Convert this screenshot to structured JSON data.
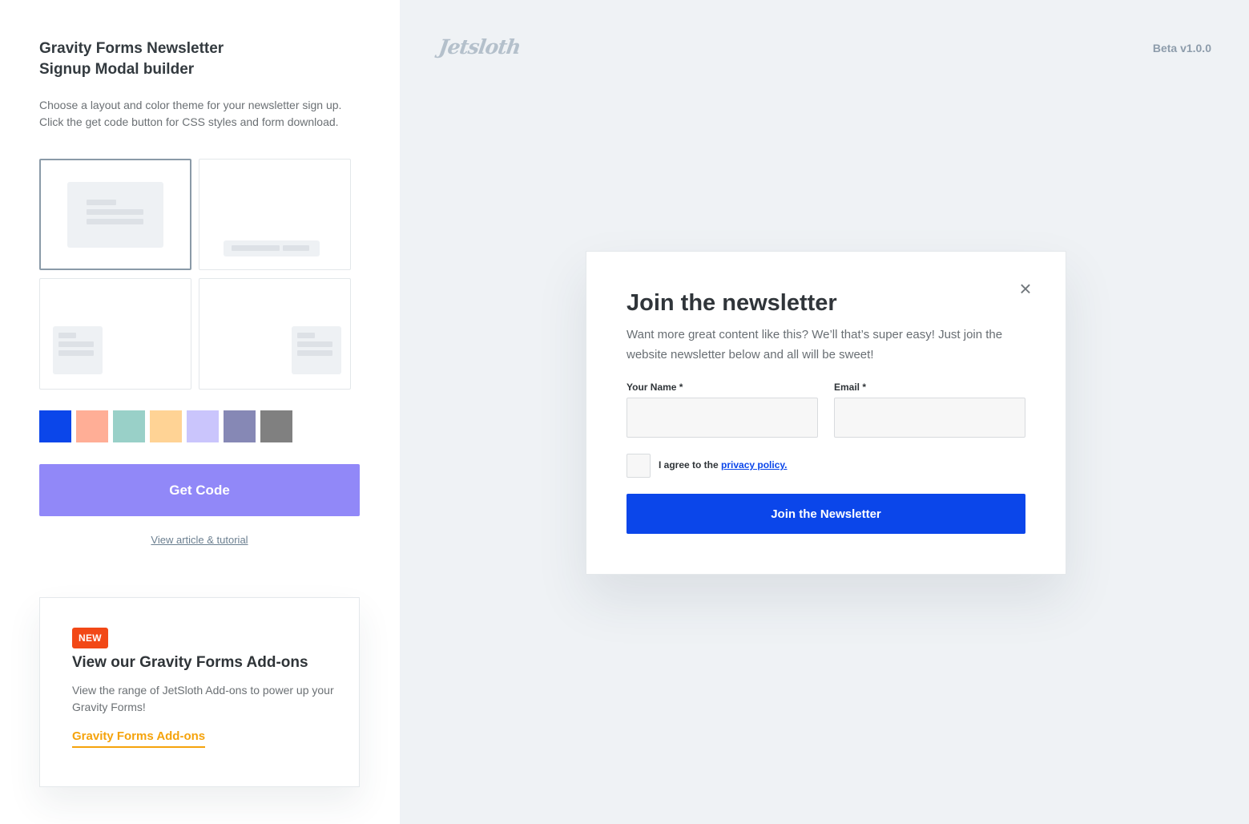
{
  "sidebar": {
    "title_line1": "Gravity Forms Newsletter",
    "title_line2": "Signup Modal builder",
    "description": "Choose a layout and color theme for your newsletter sign up. Click the get code button for CSS styles and form download.",
    "layouts": [
      {
        "name": "centered-modal",
        "selected": true
      },
      {
        "name": "bottom-bar",
        "selected": false
      },
      {
        "name": "bottom-left",
        "selected": false
      },
      {
        "name": "bottom-right",
        "selected": false
      }
    ],
    "swatches": [
      "#0b46ea",
      "#ffae96",
      "#99d0c8",
      "#ffd395",
      "#cac5fc",
      "#8688b5",
      "#808080"
    ],
    "get_code_label": "Get Code",
    "article_link": "View article & tutorial"
  },
  "promo": {
    "badge": "NEW",
    "title": "View our Gravity Forms Add-ons",
    "description": "View the range of JetSloth Add-ons to power up your Gravity Forms!",
    "link": "Gravity Forms Add-ons"
  },
  "header": {
    "logo": "Jetsloth",
    "version": "Beta v1.0.0"
  },
  "modal": {
    "title": "Join the newsletter",
    "description": "Want more great content like this? We’ll that’s super easy! Just join the website newsletter below and all will be sweet!",
    "name_label": "Your Name *",
    "email_label": "Email *",
    "consent_prefix": "I agree to the ",
    "consent_link": "privacy policy.",
    "submit_label": "Join the Newsletter",
    "close_icon": "close-icon"
  },
  "colors": {
    "accent": "#0b46ea",
    "get_code": "#9188f8",
    "badge": "#f24816",
    "promo_link": "#f5a30c"
  }
}
